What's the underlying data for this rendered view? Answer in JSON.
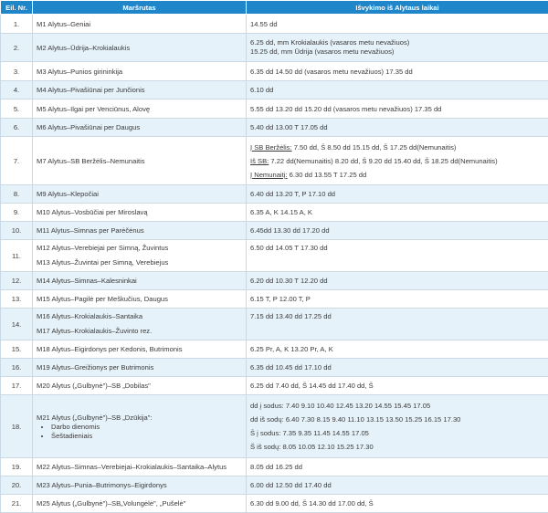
{
  "header": {
    "nr": "Eil. Nr.",
    "route": "Maršrutas",
    "times": "Išvykimo iš Alytaus laikai"
  },
  "rows": [
    {
      "nr": "1.",
      "route": "M1 Alytus–Geniai",
      "times": "14.55 dd"
    },
    {
      "nr": "2.",
      "route": "M2 Alytus–Ūdrija–Krokialaukis",
      "t1": "6.25 dd, mm Krokialaukis (vasaros metu nevažiuos)",
      "t2": "15.25 dd, mm Ūdrija (vasaros metu nevažiuos)"
    },
    {
      "nr": "3.",
      "route": "M3 Alytus–Punios girininkija",
      "times": "6.35 dd   14.50 dd (vasaros metu nevažiuos)   17.35 dd"
    },
    {
      "nr": "4.",
      "route": "M4 Alytus–Pivašiūnai per Junčionis",
      "times": "6.10 dd"
    },
    {
      "nr": "5.",
      "route": "M5 Alytus–Ilgai per Venciūnus, Alovę",
      "times": "5.55 dd   13.20 dd   15.20 dd (vasaros metu nevažiuos)   17.35 dd"
    },
    {
      "nr": "6.",
      "route": "M6 Alytus–Pivašiūnai per Daugus",
      "times": "5.40 dd   13.00 T   17.05 dd"
    },
    {
      "nr": "7.",
      "route": "M7 Alytus–SB Beržėlis–Nemunaitis",
      "t1a": "Į SB Beržėlis:",
      "t1b": " 7.50 dd, Š   8.50 dd   15.15 dd, Š   17.25 dd(Nemunaitis)",
      "t2a": "Iš SB:",
      "t2b": " 7.22 dd(Nemunaitis)   8.20 dd, Š   9.20 dd   15.40 dd, Š   18.25 dd(Nemunaitis)",
      "t3a": "Į Nemunaitį:",
      "t3b": " 6.30 dd   13.55 T   17.25 dd"
    },
    {
      "nr": "8.",
      "route": "M9 Alytus–Klepočiai",
      "times": "6.40 dd   13.20 T, P   17.10 dd"
    },
    {
      "nr": "9.",
      "route": "M10 Alytus–Vosbūčiai per Miroslavą",
      "times": "6.35 A, K   14.15 A, K"
    },
    {
      "nr": "10.",
      "route": "M11 Alytus–Simnas per Parėčėnus",
      "times": "6.45dd   13.30 dd   17.20 dd"
    },
    {
      "nr": "11.",
      "r1": "M12 Alytus–Verebiejai per Simną, Žuvintus",
      "r2": "M13 Alytus–Žuvintai per Simną, Verebiejus",
      "times": "6.50 dd   14.05 T   17.30 dd"
    },
    {
      "nr": "12.",
      "route": "M14 Alytus–Simnas–Kalesninkai",
      "times": "6.20 dd   10.30 T   12.20 dd"
    },
    {
      "nr": "13.",
      "route": "M15 Alytus–Pagilė per Meškučius, Daugus",
      "times": "6.15 T, P   12.00 T, P"
    },
    {
      "nr": "14.",
      "r1": "M16 Alytus–Krokialaukis–Santaika",
      "r2": "M17 Alytus–Krokialaukis–Žuvinto rez.",
      "times": "7.15 dd   13.40 dd   17.25 dd"
    },
    {
      "nr": "15.",
      "route": "M18 Alytus–Eigirdonys per Kedonis, Butrimonis",
      "times": "6.25 Pr, A, K   13.20 Pr, A, K"
    },
    {
      "nr": "16.",
      "route": "M19 Alytus–Greižionys per Butrimonis",
      "times": "6.35 dd   10.45 dd   17.10 dd"
    },
    {
      "nr": "17.",
      "route": "M20 Alytus („Gulbynė\")–SB „Dobilas\"",
      "times": "6.25 dd   7.40 dd, Š   14.45 dd   17.40 dd, Š"
    },
    {
      "nr": "18.",
      "route": "M21 Alytus („Gulbynė\")–SB „Dzūkija\":",
      "d1": "Darbo dienomis",
      "d2": "Šeštadieniais",
      "t1": "dd į sodus: 7.40   9.10   10.40   12.45   13.20   14.55   15.45   17.05",
      "t2": "dd iš sodų: 6.40   7.30   8.15   9.40   11.10   13.15   13.50   15.25   16.15   17.30",
      "t3": "Š į sodus: 7.35   9.35   11.45   14.55   17.05",
      "t4": "Š iš sodų: 8.05   10.05   12.10   15.25   17.30"
    },
    {
      "nr": "19.",
      "route": "M22 Alytus–Simnas–Verebiejai–Krokialaukis–Santaika–Alytus",
      "times": "8.05 dd   16.25 dd"
    },
    {
      "nr": "20.",
      "route": "M23 Alytus–Punia–Butrimonys–Eigirdonys",
      "times": "6.00 dd   12.50 dd   17.40 dd"
    },
    {
      "nr": "21.",
      "route": "M25 Alytus („Gulbynė\")–SB„Volungėlė\", „Pušelė\"",
      "times": "6.30 dd   9.00 dd, Š   14.30 dd   17.00 dd, Š"
    }
  ]
}
